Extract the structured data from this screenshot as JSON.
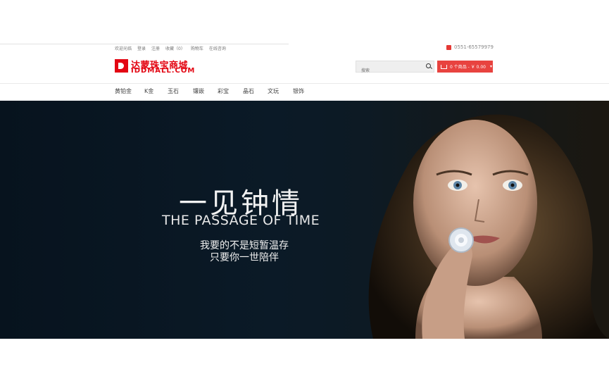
{
  "header": {
    "top_links": [
      "欢迎光临",
      "登录",
      "注册",
      "收藏（0）",
      "购物车",
      "在线咨询"
    ],
    "phone": "0551-65579979",
    "logo_name": "达蒙珠宝商城",
    "logo_domain": "IDDMALL.COM",
    "search_placeholder": "搜索",
    "cart_label": "0 个商品 - ￥ 0.00"
  },
  "nav": {
    "items": [
      "黄铂金",
      "K金",
      "玉石",
      "镶嵌",
      "彩宝",
      "晶石",
      "文玩",
      "银饰"
    ]
  },
  "banner": {
    "title": "一见钟情",
    "subtitle": "THE PASSAGE OF TIME",
    "line1": "我要的不是短暂温存",
    "line2": "只要你一世陪伴"
  },
  "colors": {
    "brand": "#e30613",
    "cart_bg": "#e8433f",
    "banner_bg": "#0b1a27"
  }
}
